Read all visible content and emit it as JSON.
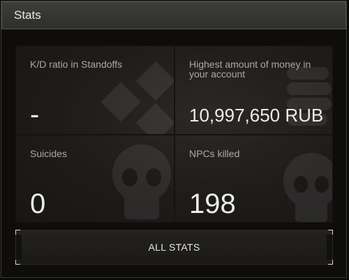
{
  "header": {
    "title": "Stats"
  },
  "stats": [
    {
      "label": "K/D ratio in Standoffs",
      "value": "-"
    },
    {
      "label": "Highest amount of money in your account",
      "value": "10,997,650 RUB"
    },
    {
      "label": "Suicides",
      "value": "0"
    },
    {
      "label": "NPCs killed",
      "value": "198"
    }
  ],
  "footer": {
    "all_stats_label": "ALL STATS"
  },
  "icons": {
    "watermarks": [
      "skull-icon",
      "diamond-pattern-icon"
    ]
  }
}
